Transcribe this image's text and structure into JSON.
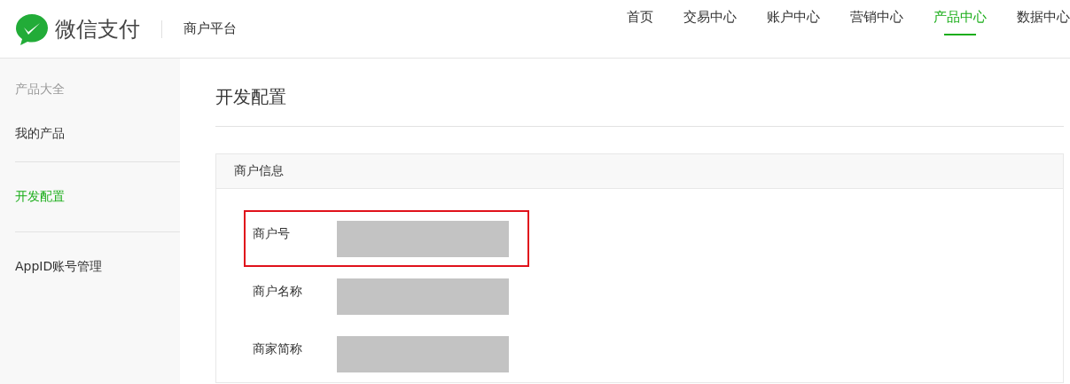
{
  "header": {
    "brand": "微信支付",
    "platform": "商户平台"
  },
  "nav": [
    {
      "label": "首页",
      "selected": false
    },
    {
      "label": "交易中心",
      "selected": false
    },
    {
      "label": "账户中心",
      "selected": false
    },
    {
      "label": "营销中心",
      "selected": false
    },
    {
      "label": "产品中心",
      "selected": true
    },
    {
      "label": "数据中心",
      "selected": false
    }
  ],
  "sidebar": {
    "groups": [
      {
        "items": [
          {
            "label": "产品大全",
            "kind": "heading"
          },
          {
            "label": "我的产品",
            "kind": "link",
            "selected": false
          }
        ]
      },
      {
        "items": [
          {
            "label": "开发配置",
            "kind": "link",
            "selected": true
          }
        ]
      },
      {
        "items": [
          {
            "label": "AppID账号管理",
            "kind": "link",
            "selected": false
          }
        ]
      }
    ]
  },
  "page": {
    "title": "开发配置"
  },
  "card": {
    "title": "商户信息",
    "fields": [
      {
        "label": "商户号",
        "highlighted": true
      },
      {
        "label": "商户名称",
        "highlighted": false
      },
      {
        "label": "商家简称",
        "highlighted": false
      }
    ]
  }
}
